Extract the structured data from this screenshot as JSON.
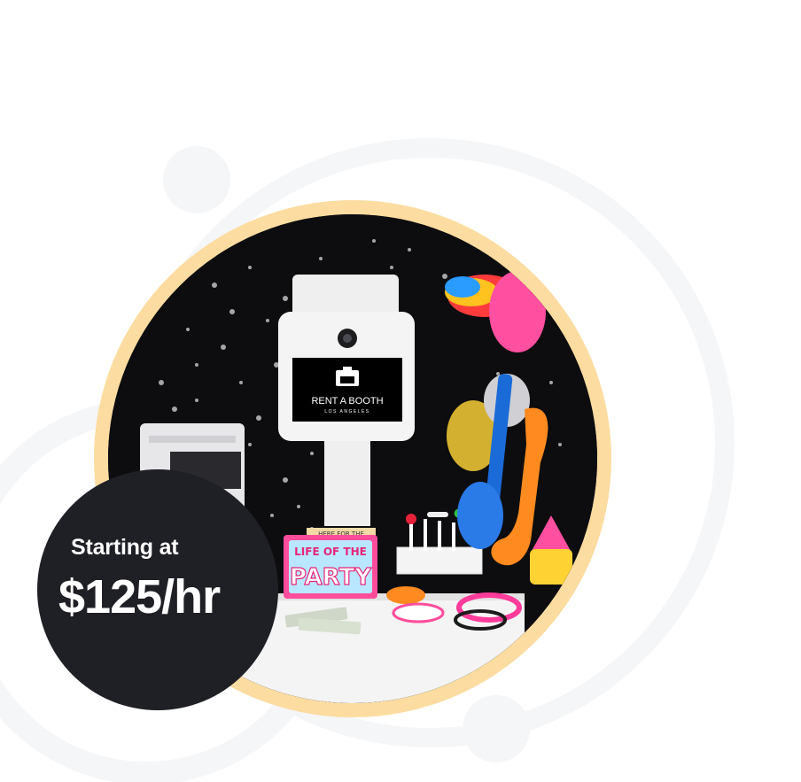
{
  "price_badge": {
    "label": "Starting at",
    "price": "$125/hr"
  },
  "booth": {
    "brand_name": "RENT A BOOTH",
    "brand_location": "LOS ANGELES",
    "brand_logo_icon": "booth-logo-icon"
  },
  "props": {
    "sign_top_text": "HERE FOR THE",
    "sign_line1": "LIFE OF THE",
    "sign_line2": "PARTY"
  },
  "colors": {
    "ring": "#fcdca0",
    "badge_background": "#1f2026",
    "badge_text": "#ffffff",
    "decoration": "#f5f6f8",
    "photo_background": "#0d0d0f"
  }
}
